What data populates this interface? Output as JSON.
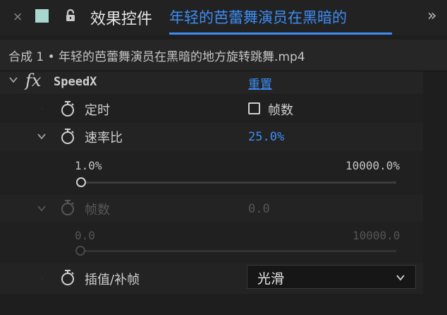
{
  "header": {
    "close_glyph": "×",
    "swatch_color": "#a9d7cf",
    "title": "效果控件",
    "layer_name": "年轻的芭蕾舞演员在黑暗的",
    "more_glyph": "»"
  },
  "composition": {
    "label": "合成 1 • 年轻的芭蕾舞演员在黑暗的地方旋转跳舞.mp4"
  },
  "effect": {
    "fx_label": "fx",
    "name": "SpeedX",
    "reset_label": "重置"
  },
  "params": {
    "timing": {
      "label": "定时",
      "checkbox_label": "帧数",
      "checked": false
    },
    "rate": {
      "label": "速率比",
      "value": "25.0%",
      "min": "1.0%",
      "max": "10000.0%",
      "fraction": 0.0024
    },
    "frames": {
      "label": "帧数",
      "value": "0.0",
      "min": "0.0",
      "max": "10000.0",
      "fraction": 0.0,
      "disabled": true
    },
    "interpolation": {
      "label": "插值/补帧",
      "selected": "光滑"
    }
  },
  "colors": {
    "accent": "#3d8df5",
    "background": "#1e1e1e"
  },
  "icons": {
    "close": "close-icon",
    "lock": "lock-icon",
    "stopwatch": "stopwatch-icon",
    "chevron": "chevron-down-icon"
  }
}
